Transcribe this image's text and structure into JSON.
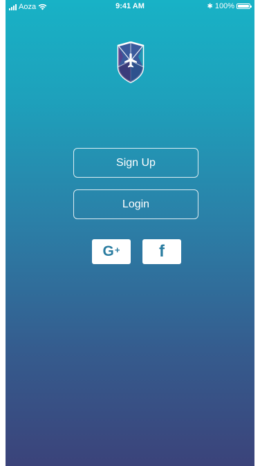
{
  "status_bar": {
    "carrier": "Aoza",
    "time": "9:41 AM",
    "bluetooth_glyph": "✱",
    "battery": "100%",
    "battery_level": 1.0
  },
  "logo": {
    "icon": "airplane-shield-logo"
  },
  "buttons": {
    "signup": "Sign Up",
    "login": "Login"
  },
  "social": {
    "google_letter": "G",
    "google_plus": "+",
    "facebook_letter": "f"
  },
  "colors": {
    "gradient_top": "#18b2c6",
    "gradient_bottom": "#3b437a",
    "white": "#ffffff",
    "social_icon": "#2a7ca0"
  }
}
